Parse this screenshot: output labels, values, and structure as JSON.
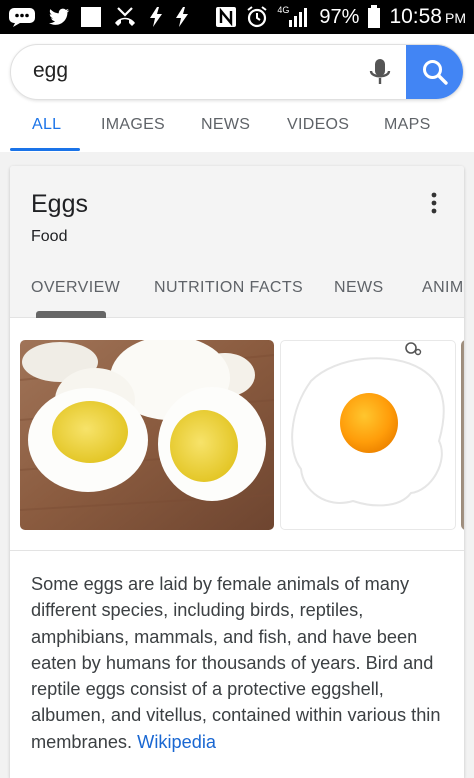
{
  "status_bar": {
    "battery": "97%",
    "time": "10:58",
    "ampm": "PM",
    "network": "4G",
    "icons": [
      "message-icon",
      "twitter-icon",
      "square-icon",
      "missed-call-icon",
      "charging-icon",
      "charging-icon",
      "nfc-icon",
      "alarm-icon",
      "signal-icon",
      "battery-icon"
    ]
  },
  "search": {
    "query": "egg"
  },
  "tabs": [
    "ALL",
    "IMAGES",
    "NEWS",
    "VIDEOS",
    "MAPS"
  ],
  "knowledge_panel": {
    "title": "Eggs",
    "subtitle": "Food",
    "subtabs": [
      "OVERVIEW",
      "NUTRITION FACTS",
      "NEWS",
      "ANIM"
    ],
    "description": "Some eggs are laid by female animals of many different species, including birds, reptiles, amphibians, mammals, and fish, and have been eaten by humans for thousands of years. Bird and reptile eggs consist of a protective eggshell, albumen, and vitellus, contained within various thin membranes.",
    "link_text": "Wikipedia"
  },
  "colors": {
    "accent": "#1a73e8",
    "search_button": "#4285f4",
    "link": "#1967d2"
  }
}
